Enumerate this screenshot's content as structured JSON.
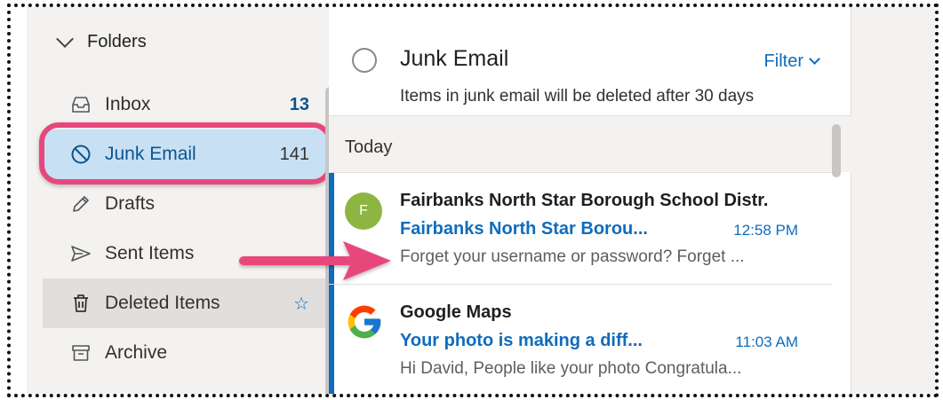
{
  "folders": {
    "header": "Folders",
    "items": [
      {
        "label": "Inbox",
        "count": "13",
        "icon": "inbox-icon"
      },
      {
        "label": "Junk Email",
        "count": "141",
        "icon": "block-icon"
      },
      {
        "label": "Drafts",
        "count": "",
        "icon": "pencil-icon"
      },
      {
        "label": "Sent Items",
        "count": "",
        "icon": "send-icon"
      },
      {
        "label": "Deleted Items",
        "count": "",
        "icon": "trash-icon"
      },
      {
        "label": "Archive",
        "count": "",
        "icon": "archive-icon"
      }
    ]
  },
  "list": {
    "title": "Junk Email",
    "filter_label": "Filter",
    "notice": "Items in junk email will be deleted after 30 days",
    "group": "Today",
    "messages": [
      {
        "avatar_letter": "F",
        "avatar_color": "#8cb641",
        "sender": "Fairbanks North Star Borough School Distr.",
        "subject": "Fairbanks North Star Borou...",
        "time": "12:58 PM",
        "preview": "Forget your username or password? Forget ..."
      },
      {
        "avatar_letter": "",
        "sender": "Google Maps",
        "subject": "Your photo is making a diff...",
        "time": "11:03 AM",
        "preview": "Hi David, People like your photo Congratula..."
      }
    ]
  },
  "colors": {
    "accent": "#0f6cbd",
    "highlight": "#e8477c",
    "selected_bg": "#c7e0f4"
  }
}
